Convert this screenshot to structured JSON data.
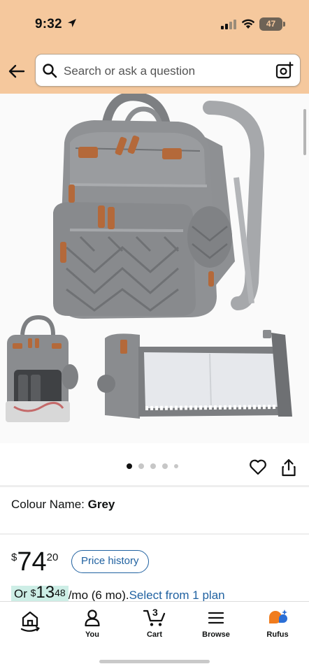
{
  "status_bar": {
    "time": "9:32",
    "battery": "47"
  },
  "search": {
    "placeholder": "Search or ask a question"
  },
  "gallery": {
    "image_count": 5,
    "active_index": 0
  },
  "product": {
    "colour_label": "Colour Name:",
    "colour_value": "Grey"
  },
  "price": {
    "currency": "$",
    "whole": "74",
    "fraction": "20",
    "history_label": "Price history"
  },
  "monthly": {
    "prefix": "Or ",
    "currency": "$",
    "whole": "13",
    "fraction": "48",
    "suffix": "/mo (6 mo).",
    "link": "Select from 1 plan"
  },
  "nav": {
    "home": "",
    "you": "You",
    "cart": "Cart",
    "cart_count": "3",
    "browse": "Browse",
    "rufus": "Rufus"
  },
  "colors": {
    "header_bg": "#f5c89d",
    "link": "#2162a1",
    "highlight": "#cdeee6",
    "rufus_orange": "#f07c1e",
    "rufus_blue": "#2b6fd6"
  }
}
